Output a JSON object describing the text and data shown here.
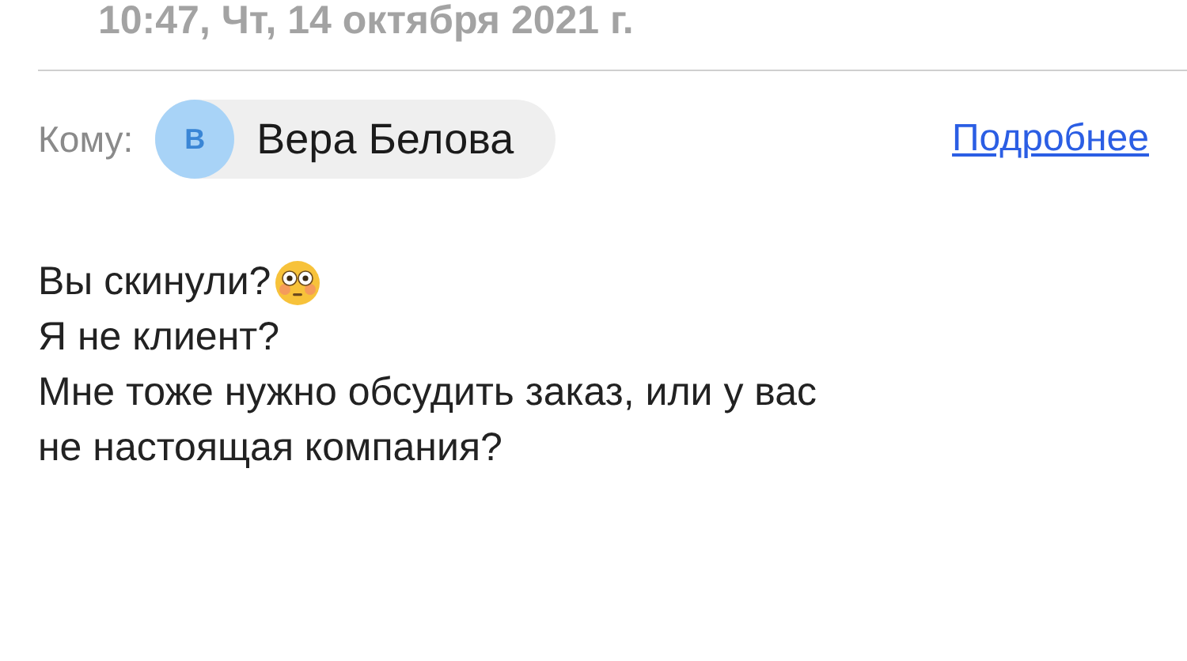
{
  "date": "10:47, Чт, 14 октября 2021 г.",
  "recipient": {
    "label": "Кому:",
    "initial": "В",
    "name": "Вера Белова"
  },
  "details_link": "Подробнее",
  "body": [
    {
      "text": "Вы скинули?",
      "emoji": true
    },
    {
      "text": "Я не клиент?",
      "emoji": false
    },
    {
      "text": "Мне тоже нужно обсудить заказ, или у вас не настоящая компания?",
      "emoji": false
    }
  ]
}
